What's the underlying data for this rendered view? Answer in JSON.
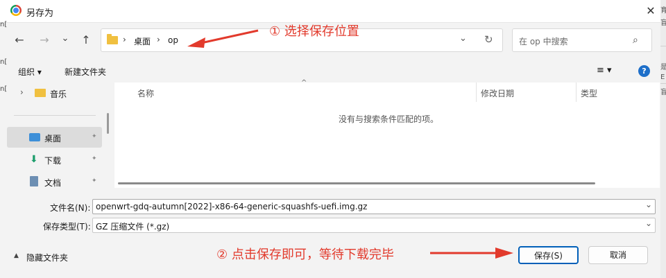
{
  "window": {
    "title": "另存为",
    "close": "✕"
  },
  "underlying": {
    "strip_chars": [
      "育",
      "盲",
      "是",
      "E",
      "盲"
    ],
    "left_chars": [
      "n[",
      "n[",
      "n["
    ]
  },
  "nav": {
    "back": "←",
    "forward": "→",
    "recent": "⌄",
    "up": "↑",
    "breadcrumb": [
      "桌面",
      "op"
    ],
    "sep": "›",
    "dropdown": "⌄",
    "refresh": "↻",
    "search_placeholder": "在 op 中搜索",
    "search_icon": "⌕"
  },
  "toolbar": {
    "organize": "组织 ▾",
    "new_folder": "新建文件夹",
    "view": "≡ ▾",
    "help": "?"
  },
  "sidebar": {
    "music": "音乐",
    "items": [
      {
        "label": "桌面",
        "pin": "📌"
      },
      {
        "label": "下载",
        "pin": "📌"
      },
      {
        "label": "文档",
        "pin": "📌"
      }
    ]
  },
  "file_list": {
    "columns": [
      "名称",
      "修改日期",
      "类型"
    ],
    "empty": "没有与搜索条件匹配的项。",
    "sort_indicator": "^"
  },
  "form": {
    "filename_label": "文件名(N):",
    "filename_value": "openwrt-gdq-autumn[2022]-x86-64-generic-squashfs-uefi.img.gz",
    "type_label": "保存类型(T):",
    "type_value": "GZ 压缩文件 (*.gz)"
  },
  "footer": {
    "hide_folders": "隐藏文件夹",
    "save": "保存(S)",
    "cancel": "取消"
  },
  "annotations": {
    "step1": "① 选择保存位置",
    "step2": "② 点击保存即可，等待下载完毕"
  },
  "colors": {
    "accent": "#005fb8",
    "annotation": "#e23a2c",
    "folder": "#f0c040"
  }
}
